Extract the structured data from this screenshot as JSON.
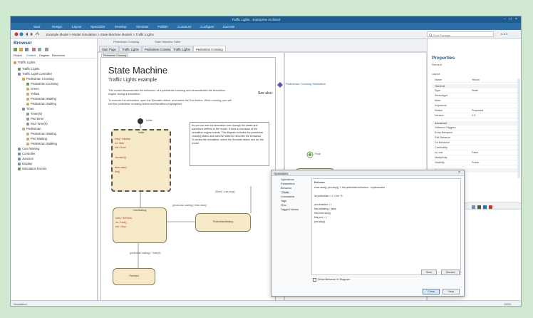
{
  "window": {
    "title": "Traffic Lights - Enterprise Architect"
  },
  "menu": [
    {
      "label": "Start",
      "x": 0
    },
    {
      "label": "Design",
      "x": 1
    },
    {
      "label": "Layout",
      "x": 2
    },
    {
      "label": "Specialize",
      "x": 3
    },
    {
      "label": "Develop",
      "x": 4
    },
    {
      "label": "Simulate",
      "x": 5
    },
    {
      "label": "Publish",
      "x": 6
    },
    {
      "label": "Construct",
      "x": 7
    },
    {
      "label": "Configure",
      "x": 8
    },
    {
      "label": "Execute",
      "x": 9
    }
  ],
  "breadcrumb": "Example Model  >  Model Simulation  >  State Machine Models  >  Traffic Lights",
  "find_placeholder": "Find Package",
  "browser": {
    "title": "Browser",
    "tabs": [
      "Project",
      "Context",
      "Diagram",
      "Resources"
    ],
    "items": [
      "Traffic Lights",
      "Traffic Lights",
      "Traffic Light Controller",
      "Pedestrian Crossing",
      "Pedestrian Crossing",
      "Green",
      "Yellow",
      "Pedestrian Waiting",
      "Pedestrian Waiting",
      "Timer",
      "Timer(5)",
      "Ped timer",
      "Red Time(5)",
      "Pedestrian",
      "Pedestrian Waiting",
      "Ped Waiting",
      "Pedestrian Walking",
      "Cars Waiting",
      "Controller",
      "Junction",
      "Display",
      "Simulation Events"
    ]
  },
  "doc_tabs": {
    "top": [
      "Pedestrian Crossing",
      "State Machine Table"
    ],
    "sub": [
      "Start Page",
      "Traffic Lights",
      "Pedestrian Crossing",
      "Traffic Lights",
      "Pedestrian Crossing"
    ]
  },
  "diagram": {
    "frame_label": "Pedestrian Crossing",
    "heading": "State Machine",
    "subheading": "Traffic Lights example",
    "para1": "This model demonstrates the behaviour of a pedestrian crossing and demonstrates the simulation engine during a simulation.",
    "para2": "To execute the simulation, open the Simulate ribbon, and select the Run button. When running, you will see the pedestrian crossing states and transitions highlighted.",
    "see_also": "See also:",
    "see_also_link": "Pedestrian Crossing Simulation",
    "initial_label": "Initial",
    "note_text": "As you can see the simulation runs through the states and transitions defined in the model. It does so because of the simulation engine events. This diagram includes the pedestrian crossing states and uses the states to describe the behaviour.",
    "note_text2": "To review the simulation, select the Simulate ribbon and run the model.",
    "states": [
      {
        "name": "Initial",
        "lines": [
          "entry / Initialize",
          "do / Wait",
          "exit / Done",
          "",
          "Junction1()",
          "timer.start()",
          "Set()"
        ]
      },
      {
        "name": "CarsWaiting",
        "lines": [
          "entry / SetTimer",
          "do / Cars()",
          "exit / Stop"
        ]
      },
      {
        "name": "PedestrianWaiting",
        "lines": []
      },
      {
        "name": "PedestrianWalking",
        "lines": []
      },
      {
        "name": "Finished",
        "lines": []
      }
    ],
    "transitions": [
      "[pedestrian waiting] / timer.start()",
      "[Timer] / ped.stop()",
      "[pedestrian waiting] / Timer(5)",
      "[Timer] / ped.stop()"
    ],
    "final_label": "Final"
  },
  "properties": {
    "title": "Properties",
    "tabs": [
      "Element",
      "Layout"
    ],
    "rows": [
      {
        "k": "Name",
        "v": "Yellow"
      },
      {
        "k": "Type",
        "v": "State"
      },
      {
        "k": "Stereotype",
        "v": ""
      },
      {
        "k": "Alias",
        "v": ""
      },
      {
        "k": "Keywords",
        "v": ""
      },
      {
        "k": "Status",
        "v": "Proposed"
      },
      {
        "k": "Version",
        "v": "1.0"
      }
    ],
    "sections": [
      "General",
      "Project",
      "Advanced"
    ],
    "rows2": [
      {
        "k": "Deferred Triggers",
        "v": ""
      },
      {
        "k": "Entry Behavior",
        "v": ""
      },
      {
        "k": "Exit Behavior",
        "v": ""
      },
      {
        "k": "Do Behavior",
        "v": ""
      },
      {
        "k": "Cardinality",
        "v": ""
      },
      {
        "k": "Is Leaf",
        "v": "False"
      },
      {
        "k": "Multiplicity",
        "v": ""
      },
      {
        "k": "Visibility",
        "v": "Public"
      }
    ]
  },
  "dialog": {
    "title": "Operations",
    "list": [
      "Operations",
      "Parameters",
      "Behavior",
      "Code",
      "Constraints",
      "Tags",
      "Files",
      "Tagged Values"
    ],
    "code_title": "Ped.exec",
    "code_lines": [
      "timer.start(); ped.stop(); // the pedestrian behaviour - implemented",
      "",
      "int pedestrian = 1; // int * 5",
      "",
      "ped.enabled = 1",
      "this.isWaiting = false",
      "this.timer.stop()",
      "this.ped = 1",
      "ped.stop()"
    ],
    "checkbox_label": "Show Behavior in Diagram",
    "buttons": {
      "save": "Save",
      "discard": "Discard",
      "close": "Close",
      "help": "Help"
    }
  },
  "status": {
    "left": "Simulation",
    "zoom": "100%"
  },
  "colors": {
    "accent": "#2b6ea8",
    "background": "#cfe8cf",
    "state_fill": "#f6e9c7"
  }
}
